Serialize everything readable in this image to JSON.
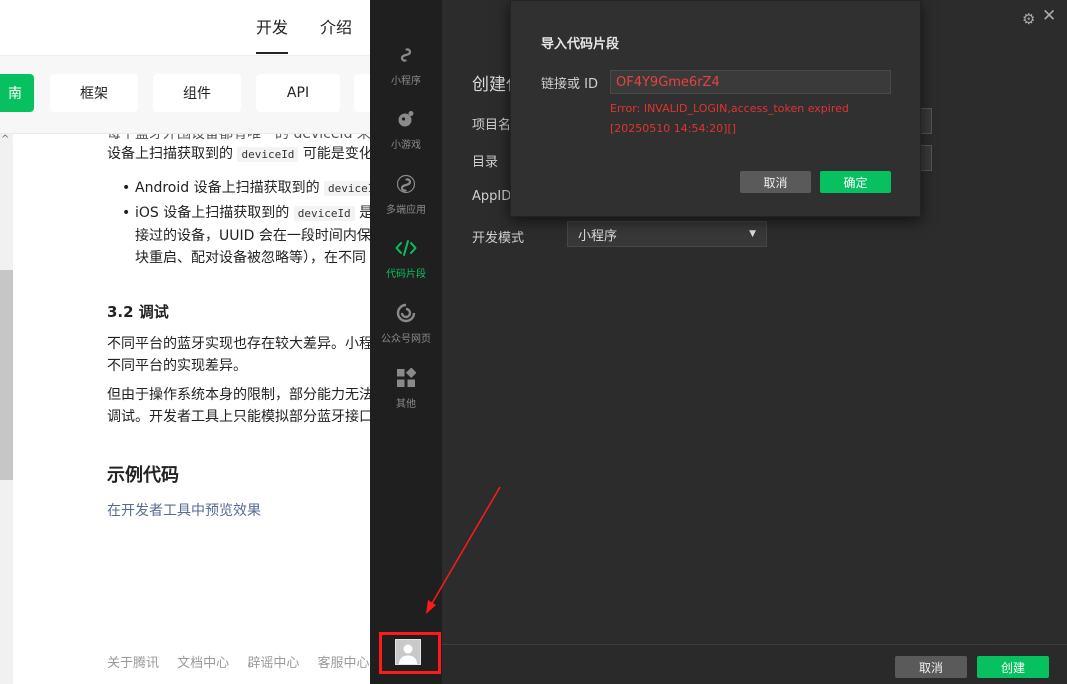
{
  "docs": {
    "nav": [
      "开发",
      "介绍"
    ],
    "categories": [
      "南",
      "框架",
      "组件",
      "API"
    ],
    "lines": {
      "l0": "每个蓝牙外围设备都有唯一的 deviceId 来",
      "l1_text": "设备上扫描获取到的",
      "l1_code": "deviceId",
      "l1_tail": "可能是变化的",
      "b1_text": "Android 设备上扫描获取到的",
      "b1_code": "deviceId",
      "b2_text": "iOS 设备上扫描获取到的",
      "b2_code": "deviceId",
      "b2_tail": "是系统",
      "b2_l2": "接过的设备，UUID 会在一段时间内保持",
      "b2_l3": "块重启、配对设备被忽略等），在不同"
    },
    "section_debug": "3.2 调试",
    "p1_l1": "不同平台的蓝牙实现也存在较大差异。小程",
    "p1_l2": "不同平台的实现差异。",
    "p2_l1": "但由于操作系统本身的限制，部分能力无法",
    "p2_l2": "调试。开发者工具上只能模拟部分蓝牙接口",
    "section_example": "示例代码",
    "preview_link": "在开发者工具中预览效果",
    "footer": [
      "关于腾讯",
      "文档中心",
      "辟谣中心",
      "客服中心"
    ]
  },
  "ide": {
    "sidebar": [
      {
        "label": "小程序",
        "icon": "miniprogram-icon",
        "active": false
      },
      {
        "label": "小游戏",
        "icon": "minigame-icon",
        "active": false
      },
      {
        "label": "多端应用",
        "icon": "multiplatform-icon",
        "active": false
      },
      {
        "label": "代码片段",
        "icon": "code-icon",
        "active": true
      },
      {
        "label": "公众号网页",
        "icon": "official-account-icon",
        "active": false
      },
      {
        "label": "其他",
        "icon": "grid-icon",
        "active": false
      }
    ],
    "title": "创建代",
    "labels": {
      "project_name": "项目名",
      "directory": "目录",
      "appid": "AppID",
      "dev_mode": "开发模式"
    },
    "dev_mode_value": "小程序",
    "cancel": "取消",
    "create": "创建"
  },
  "modal": {
    "title": "导入代码片段",
    "label": "链接或 ID",
    "input_value": "OF4Y9Gme6rZ4",
    "error_line1": "Error: INVALID_LOGIN,access_token expired",
    "error_line2": "[20250510 14:54:20][]",
    "cancel": "取消",
    "confirm": "确定"
  },
  "colors": {
    "accent": "#07c160",
    "error": "#e0342f",
    "highlight": "#ff1a1a"
  }
}
